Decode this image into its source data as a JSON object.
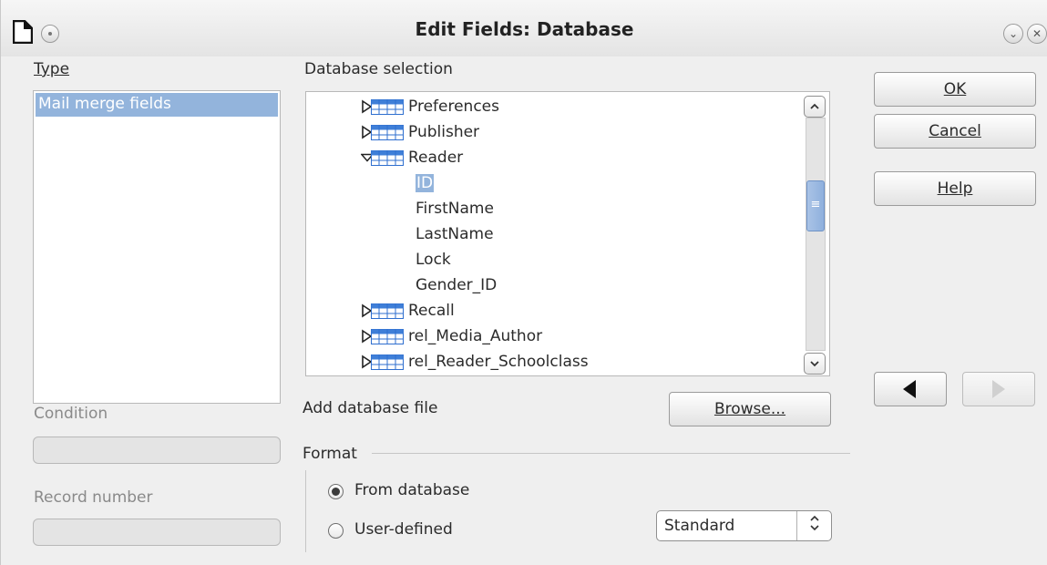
{
  "window": {
    "title": "Edit Fields: Database",
    "minimize_glyph": "⌄",
    "close_glyph": "✕"
  },
  "type_section": {
    "label": "Type",
    "items": [
      "Mail merge fields"
    ],
    "selected": "Mail merge fields"
  },
  "condition": {
    "label": "Condition",
    "value": ""
  },
  "record_number": {
    "label": "Record number",
    "value": ""
  },
  "database_selection": {
    "label": "Database selection",
    "tree": [
      {
        "name": "Preferences",
        "expanded": false
      },
      {
        "name": "Publisher",
        "expanded": false
      },
      {
        "name": "Reader",
        "expanded": true,
        "children": [
          "ID",
          "FirstName",
          "LastName",
          "Lock",
          "Gender_ID"
        ],
        "selected_child": "ID"
      },
      {
        "name": "Recall",
        "expanded": false
      },
      {
        "name": "rel_Media_Author",
        "expanded": false
      },
      {
        "name": "rel_Reader_Schoolclass",
        "expanded": false
      }
    ],
    "scrollbar_thumb_glyph": "≡"
  },
  "add_database": {
    "label": "Add database file",
    "browse_label": "Browse..."
  },
  "format": {
    "label": "Format",
    "options": [
      {
        "label": "From database",
        "checked": true
      },
      {
        "label": "User-defined",
        "checked": false
      }
    ],
    "combo_value": "Standard"
  },
  "buttons": {
    "ok": "OK",
    "cancel": "Cancel",
    "help": "Help"
  },
  "colors": {
    "selection": "#93b4dc",
    "background": "#efefef",
    "table_icon": "#3f7fd8"
  }
}
